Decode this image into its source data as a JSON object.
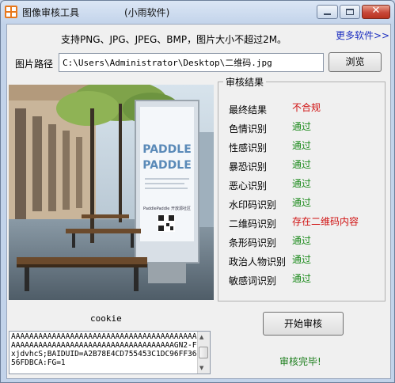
{
  "window": {
    "title": "图像审核工具",
    "subtitle": "(小雨软件)",
    "close_glyph": "✕"
  },
  "header": {
    "description": "支持PNG、JPG、JPEG、BMP，图片大小不超过2M。",
    "more_link": "更多软件>>"
  },
  "path": {
    "label": "图片路径",
    "value": "C:\\Users\\Administrator\\Desktop\\二维码.jpg",
    "browse_label": "浏览"
  },
  "poster": {
    "line1": "PADDLE",
    "line2": "PADDLE",
    "footer": "PaddlePaddle 开放源社区"
  },
  "results": {
    "title": "审核结果",
    "items": [
      {
        "label": "最终结果",
        "value": "不合规",
        "status": "fail"
      },
      {
        "label": "色情识别",
        "value": "通过",
        "status": "pass"
      },
      {
        "label": "性感识别",
        "value": "通过",
        "status": "pass"
      },
      {
        "label": "暴恐识别",
        "value": "通过",
        "status": "pass"
      },
      {
        "label": "恶心识别",
        "value": "通过",
        "status": "pass"
      },
      {
        "label": "水印码识别",
        "value": "通过",
        "status": "pass"
      },
      {
        "label": "二维码识别",
        "value": "存在二维码内容",
        "status": "fail"
      },
      {
        "label": "条形码识别",
        "value": "通过",
        "status": "pass"
      },
      {
        "label": "政治人物识别",
        "value": "通过",
        "status": "pass"
      },
      {
        "label": "敏感词识别",
        "value": "通过",
        "status": "pass"
      }
    ]
  },
  "cookie": {
    "label": "cookie",
    "value": "AAAAAAAAAAAAAAAAAAAAAAAAAAAAAAAAAAAAAAAAAAAAAAAAAAAAAAAAAAAAAAAAAAAAAAAAAAAAAGN2-FxjdvhcS;BAIDUID=A2B78E4CD755453C1DC96FF3656FDBCA:FG=1"
  },
  "actions": {
    "start_label": "开始审核",
    "done_text": "审核完毕!"
  },
  "colors": {
    "pass": "#1b8a1b",
    "fail": "#d01010",
    "link": "#1d2fc0"
  }
}
